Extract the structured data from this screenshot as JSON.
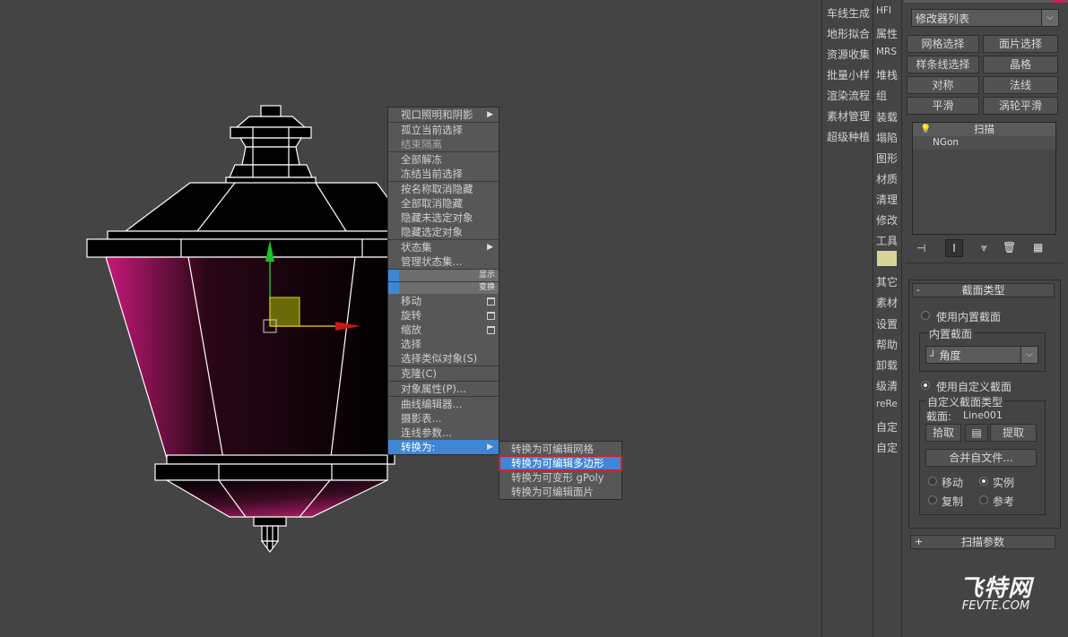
{
  "viewport": {
    "name": "perspective-viewport"
  },
  "quad_menu": {
    "items": [
      {
        "label": "视口照明和阴影",
        "arrow": "▶",
        "dim": false
      },
      {
        "label": "孤立当前选择",
        "dim": false,
        "sep": true
      },
      {
        "label": "结束隔离",
        "dim": true
      },
      {
        "label": "全部解冻",
        "dim": false,
        "sep": true
      },
      {
        "label": "冻结当前选择",
        "dim": false
      },
      {
        "label": "按名称取消隐藏",
        "dim": false,
        "sep": true
      },
      {
        "label": "全部取消隐藏",
        "dim": false
      },
      {
        "label": "隐藏未选定对象",
        "dim": false
      },
      {
        "label": "隐藏选定对象",
        "dim": false
      },
      {
        "label": "状态集",
        "arrow": "▶",
        "dim": false,
        "sep": true
      },
      {
        "label": "管理状态集...",
        "dim": false
      }
    ],
    "header_display": "显示",
    "header_transform": "变换",
    "transform_items": [
      {
        "label": "移动",
        "box": true
      },
      {
        "label": "旋转",
        "box": true
      },
      {
        "label": "缩放",
        "box": true
      },
      {
        "label": "选择",
        "box": false
      },
      {
        "label": "选择类似对象(S)",
        "box": false
      },
      {
        "label": "克隆(C)",
        "box": false,
        "sep": true
      },
      {
        "label": "对象属性(P)...",
        "box": false,
        "sep": true
      },
      {
        "label": "曲线编辑器...",
        "box": false,
        "sep": true
      },
      {
        "label": "摄影表...",
        "box": false
      },
      {
        "label": "连线参数...",
        "box": false
      },
      {
        "label": "转换为:",
        "box": false,
        "arrow": "▶",
        "selected": true
      }
    ]
  },
  "convert_submenu": [
    {
      "label": "转换为可编辑网格"
    },
    {
      "label": "转换为可编辑多边形",
      "highlighted": true
    },
    {
      "label": "转换为可变形 gPoly"
    },
    {
      "label": "转换为可编辑面片"
    }
  ],
  "script_tabs_left": [
    "车线生成",
    "地形拟合",
    "资源收集",
    "批量小样",
    "渲染流程",
    "素材管理",
    "超级种植"
  ],
  "script_tabs_mid": [
    "HFI",
    "属性",
    "MRS",
    "堆栈",
    "组",
    "装载",
    "塌陷",
    "图形",
    "材质",
    "清理",
    "修改",
    "工具",
    "",
    "其它",
    "素材",
    "设置",
    "帮助",
    "卸载",
    "级清",
    "reRe",
    "自定",
    "自定"
  ],
  "command_panel": {
    "modifier_list": "修改器列表",
    "buttons": [
      "网格选择",
      "面片选择",
      "样条线选择",
      "晶格",
      "对称",
      "法线",
      "平滑",
      "涡轮平滑"
    ],
    "stack_top": "扫描",
    "stack_sub": "NGon",
    "rollout_section_type": "截面类型",
    "use_builtin": "使用内置截面",
    "builtin_group": "内置截面",
    "builtin_value": "角度",
    "use_custom": "使用自定义截面",
    "custom_group": "自定义截面类型",
    "section_label": "截面:",
    "section_value": "Line001",
    "pick_button": "拾取",
    "extract_button": "提取",
    "merge_button": "合并自文件...",
    "opt_move": "移动",
    "opt_instance": "实例",
    "opt_copy": "复制",
    "opt_reference": "参考",
    "rollout_sweep_params": "扫描参数",
    "minus_sign": "-",
    "plus_sign": "+"
  },
  "watermark": {
    "big": "飞特网",
    "small": "FEVTE.COM"
  },
  "colors": {
    "menu_bg": "#575757",
    "highlight": "#3f86d6",
    "red_outline": "#d0202a",
    "viewport_bg": "#444444"
  }
}
